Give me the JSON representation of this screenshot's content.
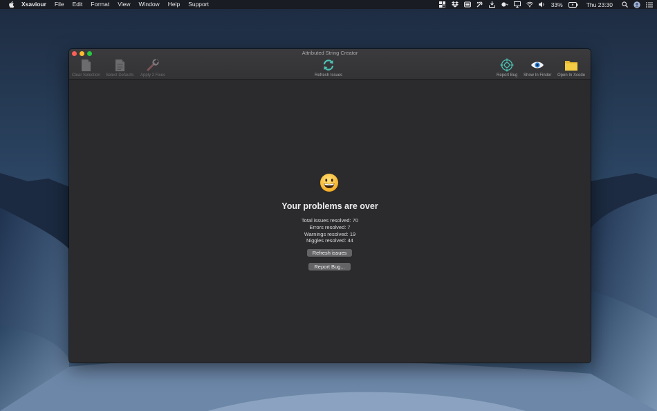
{
  "menubar": {
    "app_name": "Xsaviour",
    "menus": [
      "File",
      "Edit",
      "Format",
      "View",
      "Window",
      "Help",
      "Support"
    ],
    "battery": "33%",
    "clock": "Thu 23:30"
  },
  "window": {
    "title": "Attributed String Creator",
    "toolbar": {
      "clear_selection": "Clear Selection",
      "select_defaults": "Select Defaults",
      "apply_fixes": "Apply 2 Fixes",
      "refresh_issues": "Refresh Issues",
      "report_bug": "Report Bug",
      "show_in_finder": "Show In Finder",
      "open_in_xcode": "Open In Xcode"
    }
  },
  "content": {
    "headline": "Your problems are over",
    "stats": {
      "total": "Total issues resolved: 70",
      "errors": "Errors resolved: 7",
      "warnings": "Warnings resolved: 19",
      "niggles": "Niggles resolved: 44"
    },
    "refresh_button": "Refresh issues",
    "report_button": "Report Bug..."
  },
  "colors": {
    "window_bg": "#2b2b2d",
    "button_bg": "#646467",
    "close": "#fe5f57",
    "minimize": "#febc2e",
    "maximize": "#28c840"
  }
}
